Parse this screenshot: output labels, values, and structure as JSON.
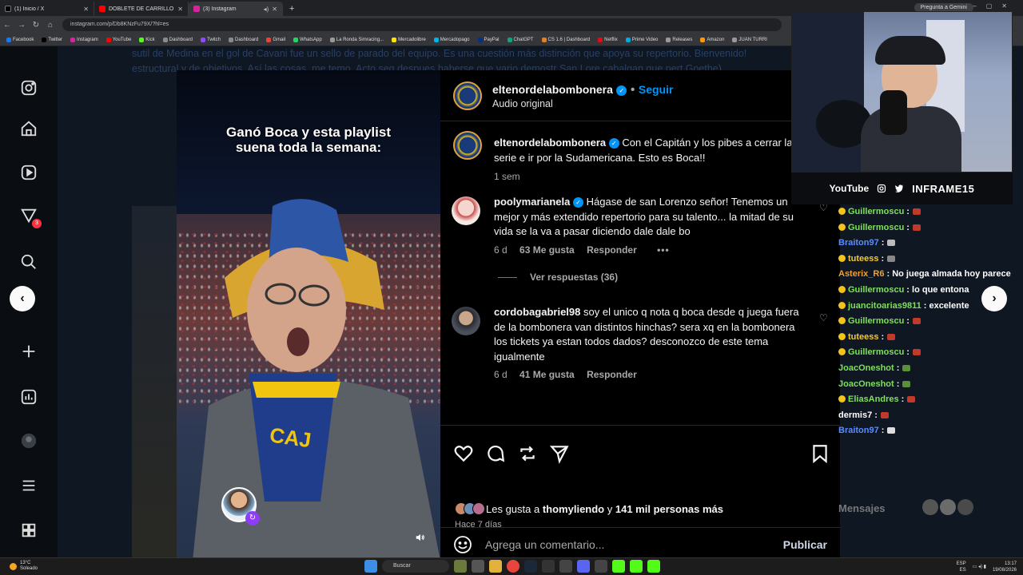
{
  "browser": {
    "tabs": [
      {
        "title": "(1) Inicio / X",
        "color": "#000000"
      },
      {
        "title": "DOBLETE DE CARRILLO Y GOLAZO",
        "color": "#ff0000"
      },
      {
        "title": "(3) Instagram",
        "color": "#d6249f"
      }
    ],
    "gemini_label": "Pregunta a Gemini",
    "url": "instagram.com/p/Db8KNzFu79X/?hl=es",
    "bookmarks": [
      "Facebook",
      "Twitter",
      "Instagram",
      "YouTube",
      "Kick",
      "Dashboard",
      "Twitch",
      "Dashboard",
      "Gmail",
      "WhatsApp",
      "La Ronda Simracing...",
      "Mercadolibre",
      "Mercadopago",
      "PayPal",
      "ChatGPT",
      "CS 1.6 | Dashboard",
      "Netflix",
      "Prime Video",
      "Releases",
      "Amazon",
      "JUAN TURRI"
    ]
  },
  "background_article": {
    "text": "sutil de Medina en el gol de Cavani fue un sello de parado del equipo. Es una cuestión más distinción que apoya su repertorio. Bienvenido! estructural y de objetivos. Así las cosas, me temo. Acto seg despues haberse que vario demostr San Lore cabalgan que pert Goethe)."
  },
  "sidebar": {
    "notifications_count": "3"
  },
  "video": {
    "caption": "Ganó Boca y esta playlist suena toda la semana:"
  },
  "post": {
    "author": "eltenordelabombonera",
    "follow_label": "Seguir",
    "audio_label": "Audio original",
    "caption_author": "eltenordelabombonera",
    "caption_text": "Con el Capitán y los pibes a cerrar la serie e ir por la Sudamericana. Esto es Boca!!",
    "caption_time": "1 sem",
    "comments": [
      {
        "user": "poolymarianela",
        "text": "Hágase de san Lorenzo señor! Tenemos un mejor y más extendido repertorio para su talento... la mitad de su vida se la va a pasar diciendo dale dale bo",
        "time": "6 d",
        "likes": "63 Me gusta",
        "reply": "Responder",
        "view_replies": "Ver respuestas (36)"
      },
      {
        "user": "cordobagabriel98",
        "text": "soy el unico q nota q boca desde q juega fuera de la bombonera van distintos hinchas? sera xq en la bombonera los tickets ya estan todos dados? desconozco de este tema igualmente",
        "time": "6 d",
        "likes": "41 Me gusta",
        "reply": "Responder"
      }
    ],
    "likes_prefix": "Les gusta a",
    "likes_user": "thomyliendo",
    "likes_joiner": "y",
    "likes_count": "141 mil personas más",
    "posted_ago": "Hace 7 días",
    "comment_placeholder": "Agrega un comentario...",
    "publish_label": "Publicar"
  },
  "stream": {
    "platform": "YouTube",
    "handle": "INFRAME15",
    "chat": [
      {
        "user": "Guillermoscu",
        "color": "#7ee05a",
        "badge": true,
        "msg": ":",
        "emote": "#c0392b"
      },
      {
        "user": "Guillermoscu",
        "color": "#7ee05a",
        "badge": true,
        "msg": ":",
        "emote": "#c0392b"
      },
      {
        "user": "Braiton97",
        "color": "#5b8cff",
        "badge": false,
        "msg": ":",
        "emote": "#bbbbbb"
      },
      {
        "user": "tuteess",
        "color": "#f0c93a",
        "badge": true,
        "msg": ":",
        "emote": "#888888"
      },
      {
        "user": "Asterix_R6",
        "color": "#f0a030",
        "badge": false,
        "msg": ": No juega almada hoy parece",
        "emote": ""
      },
      {
        "user": "Guillermoscu",
        "color": "#7ee05a",
        "badge": true,
        "msg": ": lo que entona",
        "emote": ""
      },
      {
        "user": "juancitoarias9811",
        "color": "#7ee05a",
        "badge": true,
        "msg": ": excelente",
        "emote": ""
      },
      {
        "user": "Guillermoscu",
        "color": "#7ee05a",
        "badge": true,
        "msg": ":",
        "emote": "#c0392b"
      },
      {
        "user": "tuteess",
        "color": "#f0c93a",
        "badge": true,
        "msg": ":",
        "emote": "#c0392b"
      },
      {
        "user": "Guillermoscu",
        "color": "#7ee05a",
        "badge": true,
        "msg": ":",
        "emote": "#c0392b"
      },
      {
        "user": "JoacOneshot",
        "color": "#7ee05a",
        "badge": false,
        "msg": ":",
        "emote": "#5a8f3c"
      },
      {
        "user": "JoacOneshot",
        "color": "#7ee05a",
        "badge": false,
        "msg": ":",
        "emote": "#5a8f3c"
      },
      {
        "user": "EliasAndres",
        "color": "#7ee05a",
        "badge": true,
        "msg": ":",
        "emote": "#c0392b"
      },
      {
        "user": "dermis7",
        "color": "#ffffff",
        "badge": false,
        "msg": ":",
        "emote": "#c0392b"
      },
      {
        "user": "Braiton97",
        "color": "#5b8cff",
        "badge": false,
        "msg": ":",
        "emote": "#dddddd"
      }
    ],
    "chat_input_label": "Mensajes"
  },
  "taskbar": {
    "temp": "13°C",
    "weather": "Soleado",
    "search_label": "Buscar",
    "lang": "ESP",
    "lang2": "ES",
    "clock": "13:17",
    "date": "19/08/2026"
  }
}
